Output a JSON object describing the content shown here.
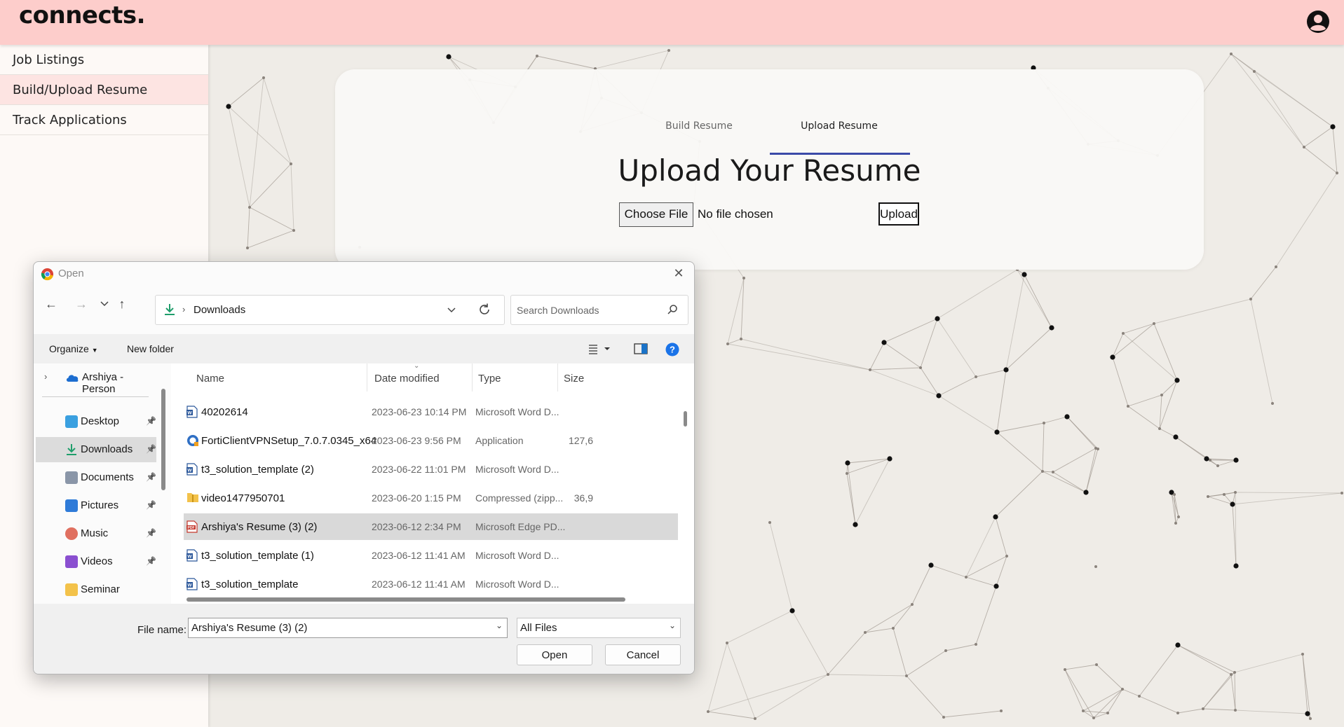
{
  "header": {
    "brand": "connects.",
    "account_icon": "account-circle-icon"
  },
  "sidebar": {
    "items": [
      {
        "label": "Job Listings",
        "active": false
      },
      {
        "label": "Build/Upload Resume",
        "active": true
      },
      {
        "label": "Track Applications",
        "active": false
      }
    ]
  },
  "upload": {
    "tabs": [
      {
        "label": "Build Resume"
      },
      {
        "label": "Upload Resume",
        "active": true
      }
    ],
    "title": "Upload Your Resume",
    "choose_label": "Choose File",
    "file_status": "No file chosen",
    "upload_label": "Upload",
    "accent": "#3b4aa8"
  },
  "dialog": {
    "title": "Open",
    "address": {
      "folder": "Downloads"
    },
    "search_placeholder": "Search Downloads",
    "commands": {
      "organize": "Organize",
      "new_folder": "New folder"
    },
    "nav": {
      "cloud": "Arshiya - Person",
      "items": [
        {
          "label": "Desktop",
          "icon": "desktop-icon",
          "color": "#3aa0e0"
        },
        {
          "label": "Downloads",
          "icon": "download-icon",
          "color": "#1f9e6b",
          "selected": true
        },
        {
          "label": "Documents",
          "icon": "documents-icon",
          "color": "#8a96a8"
        },
        {
          "label": "Pictures",
          "icon": "pictures-icon",
          "color": "#2f7bd8"
        },
        {
          "label": "Music",
          "icon": "music-icon",
          "color": "#e07060"
        },
        {
          "label": "Videos",
          "icon": "videos-icon",
          "color": "#8a4fd0"
        },
        {
          "label": "Seminar",
          "icon": "folder-icon",
          "color": "#f3c24a"
        }
      ]
    },
    "columns": {
      "name": "Name",
      "date": "Date modified",
      "type": "Type",
      "size": "Size"
    },
    "files": [
      {
        "name": "40202614",
        "date": "2023-06-23 10:14 PM",
        "type": "Microsoft Word D...",
        "size": "",
        "icon": "word-icon"
      },
      {
        "name": "FortiClientVPNSetup_7.0.7.0345_x64",
        "date": "2023-06-23 9:56 PM",
        "type": "Application",
        "size": "127,6",
        "icon": "app-icon"
      },
      {
        "name": "t3_solution_template (2)",
        "date": "2023-06-22 11:01 PM",
        "type": "Microsoft Word D...",
        "size": "",
        "icon": "word-icon"
      },
      {
        "name": "video1477950701",
        "date": "2023-06-20 1:15 PM",
        "type": "Compressed (zipp...",
        "size": "36,9",
        "icon": "zip-folder-icon"
      },
      {
        "name": "Arshiya's Resume (3) (2)",
        "date": "2023-06-12 2:34 PM",
        "type": "Microsoft Edge PD...",
        "size": "",
        "icon": "pdf-icon",
        "selected": true
      },
      {
        "name": "t3_solution_template (1)",
        "date": "2023-06-12 11:41 AM",
        "type": "Microsoft Word D...",
        "size": "",
        "icon": "word-icon"
      },
      {
        "name": "t3_solution_template",
        "date": "2023-06-12 11:41 AM",
        "type": "Microsoft Word D...",
        "size": "",
        "icon": "word-icon"
      }
    ],
    "file_name_label": "File name:",
    "file_name_value": "Arshiya's Resume (3) (2)",
    "file_type": "All Files",
    "open_label": "Open",
    "cancel_label": "Cancel"
  }
}
